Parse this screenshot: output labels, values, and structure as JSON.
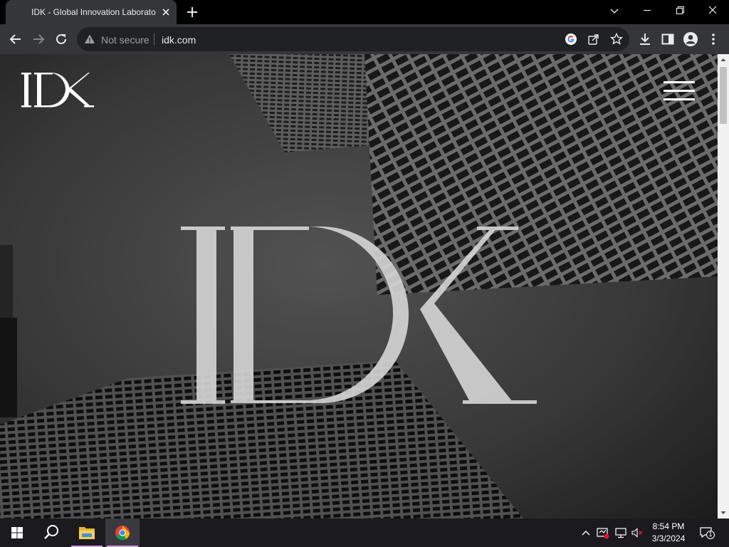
{
  "browser": {
    "tab": {
      "title": "IDK - Global Innovation Laborato"
    },
    "omnibox": {
      "security_label": "Not secure",
      "url": "idk.com"
    }
  },
  "page": {
    "logo_text": "IDK",
    "center_logo_text": "IDK"
  },
  "taskbar": {
    "time": "8:54 PM",
    "date": "3/3/2024",
    "notification_count": "1"
  },
  "colors": {
    "tab_bg": "#35363a",
    "toolbar_bg": "#35363a",
    "omnibox_bg": "#202124",
    "taskbar_bg": "#1b1a1f"
  },
  "icons": [
    "tab-favicon-icon",
    "close-icon",
    "plus-icon",
    "chevron-down-icon",
    "minimize-icon",
    "restore-icon",
    "close-window-icon",
    "back-arrow-icon",
    "forward-arrow-icon",
    "reload-icon",
    "warning-icon",
    "google-icon",
    "share-icon",
    "star-icon",
    "download-icon",
    "side-panel-icon",
    "profile-icon",
    "more-vert-icon",
    "hamburger-menu-icon",
    "windows-start-icon",
    "search-icon",
    "file-explorer-icon",
    "chrome-icon",
    "chevron-up-icon",
    "network-icon",
    "volume-muted-icon",
    "notification-icon"
  ]
}
